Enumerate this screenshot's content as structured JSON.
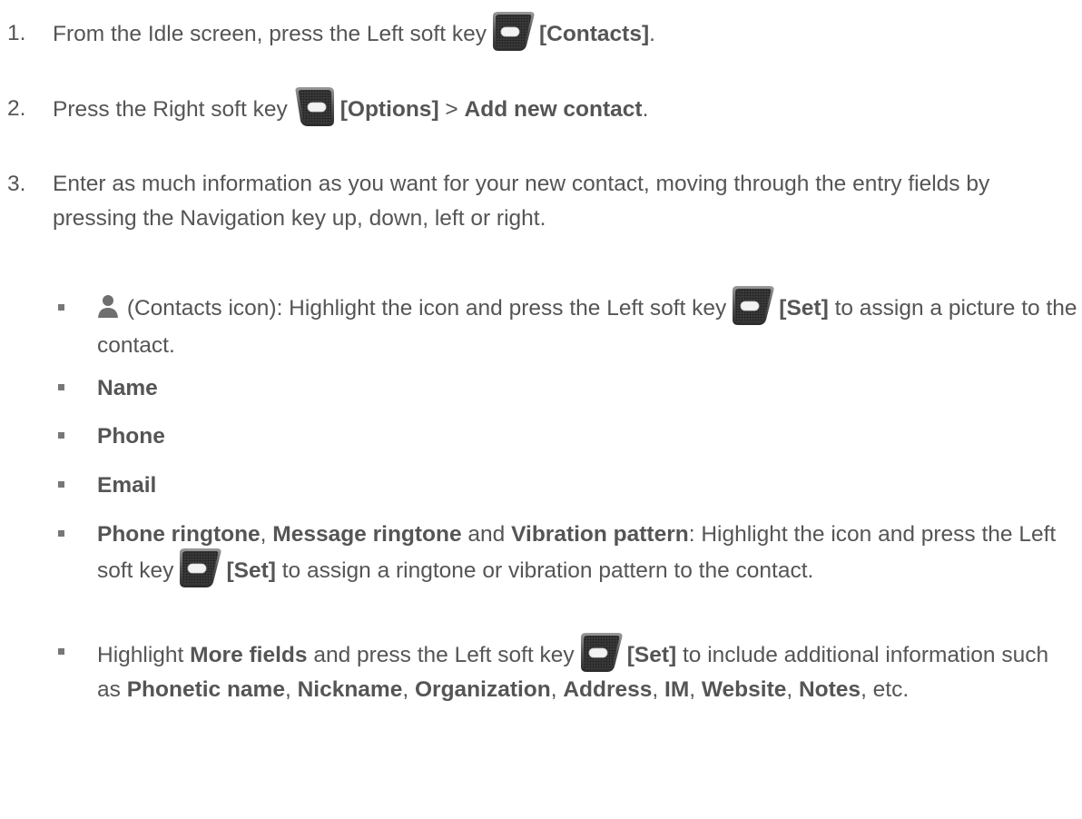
{
  "steps": [
    {
      "number": "1.",
      "before": "From the Idle screen, press the Left soft key",
      "key_label": "[Contacts]",
      "after": "."
    },
    {
      "number": "2.",
      "before": "Press the Right soft key",
      "key_label": "[Options]",
      "sep": ">",
      "menu_item": "Add new contact",
      "after": "."
    },
    {
      "number": "3.",
      "text": "Enter as much information as you want for your new contact, moving through the entry fields by pressing the Navigation key up, down, left or right."
    }
  ],
  "bullets": {
    "contacts_icon": {
      "label": "(Contacts icon): Highlight the icon and press the Left soft key",
      "key_label": "[Set]",
      "after": "to assign a picture to the contact."
    },
    "name": "Name",
    "phone": "Phone",
    "email": "Email",
    "ringtone": {
      "phone_ringtone": "Phone ringtone",
      "comma": ",",
      "message_ringtone": "Message ringtone",
      "and": "and",
      "vibration_pattern": "Vibration pattern",
      "middle": ": Highlight the icon and press the Left soft key",
      "key_label": "[Set]",
      "after": "to assign a ringtone or vibration pattern to the contact."
    },
    "more_fields": {
      "highlight": "Highlight",
      "more_fields": "More fields",
      "middle": "and press the Left soft key",
      "key_label": "[Set]",
      "after": "to include additional information such as",
      "items": [
        "Phonetic name",
        "Nickname",
        "Organization",
        "Address",
        "IM",
        "Website",
        "Notes"
      ],
      "sep": ",",
      "etc": ", etc."
    }
  },
  "icons": {
    "left_soft_key": "left-soft-key-icon",
    "right_soft_key": "right-soft-key-icon",
    "contacts": "person-icon"
  }
}
